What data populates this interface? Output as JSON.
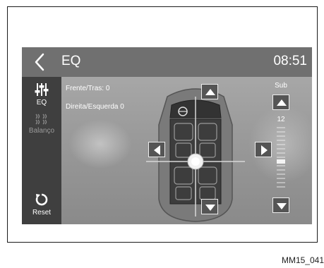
{
  "header": {
    "title": "EQ",
    "clock": "08:51"
  },
  "sidebar": {
    "items": [
      {
        "label": "EQ",
        "icon": "equalizer-icon"
      },
      {
        "label": "Balanço",
        "icon": "balance-icon"
      },
      {
        "label": "Reset",
        "icon": "reset-icon"
      }
    ]
  },
  "balance": {
    "front_rear_label": "Frente/Tras: 0",
    "left_right_label": "Direita/Esquerda 0"
  },
  "sub": {
    "title": "Sub",
    "value": "12"
  },
  "caption": "MM15_041"
}
